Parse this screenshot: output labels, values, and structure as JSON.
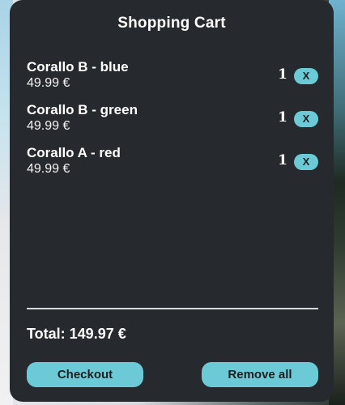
{
  "cart": {
    "title": "Shopping Cart",
    "items": [
      {
        "name": "Corallo B - blue",
        "price": "49.99 €",
        "quantity": "1",
        "remove_label": "X"
      },
      {
        "name": "Corallo B - green",
        "price": "49.99 €",
        "quantity": "1",
        "remove_label": "X"
      },
      {
        "name": "Corallo A - red",
        "price": "49.99 €",
        "quantity": "1",
        "remove_label": "X"
      }
    ],
    "total": "Total: 149.97 €",
    "checkout_label": "Checkout",
    "remove_all_label": "Remove all"
  },
  "colors": {
    "panel_background": "#26292d",
    "accent": "#6ccad6",
    "text": "#ffffff"
  }
}
